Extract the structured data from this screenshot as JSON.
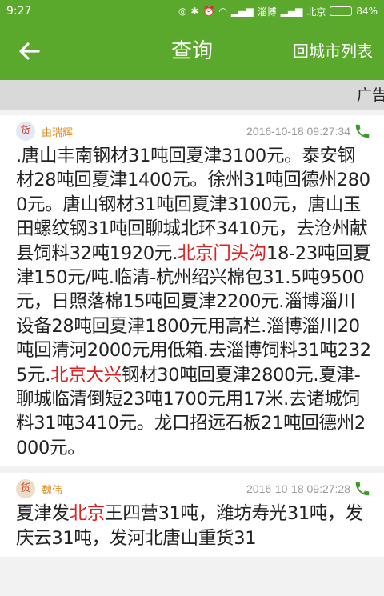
{
  "statusbar": {
    "time": "9:27",
    "carrier1": "淄博",
    "carrier2": "北京",
    "battery": "84%",
    "battery_level": 0.84
  },
  "nav": {
    "title": "查询",
    "right_button": "回城市列表"
  },
  "ad": {
    "label": "广告"
  },
  "posts": [
    {
      "badge": "货",
      "name": "由瑞辉",
      "time": "2016-10-18 09:27:34",
      "segments": [
        {
          "text": ".唐山丰南钢材31吨回夏津3100元。泰安钢材28吨回夏津1400元。徐州31吨回德州2800元。唐山钢材31吨回夏津3100元，唐山玉田螺纹钢31吨回聊城北环3410元，去沧州献县饲料32吨1920元.",
          "highlight": false
        },
        {
          "text": "北京门头沟",
          "highlight": true
        },
        {
          "text": "18-23吨回夏津150元/吨.临清-杭州绍兴棉包31.5吨9500元，日照落棉15吨回夏津2200元.淄博淄川设备28吨回夏津1800元用高栏.淄博淄川20吨回清河2000元用低箱.去淄博饲料31吨2325元.",
          "highlight": false
        },
        {
          "text": "北京大兴",
          "highlight": true
        },
        {
          "text": "钢材30吨回夏津2800元.夏津-聊城临清倒短23吨1700元用17米.去诸城饲料31吨3410元。龙口招远石板21吨回德州2000元。",
          "highlight": false
        }
      ]
    },
    {
      "badge": "货",
      "name": "魏伟",
      "time": "2016-10-18 09:27:28",
      "segments": [
        {
          "text": "夏津发",
          "highlight": false
        },
        {
          "text": "北京",
          "highlight": true
        },
        {
          "text": "王四营31吨，潍坊寿光31吨，发庆云31吨，发河北唐山重货31",
          "highlight": false
        }
      ]
    }
  ],
  "colors": {
    "primary": "#5aa82c",
    "highlight": "#e02020",
    "publisher": "#e08a1e",
    "phone": "#3a9a2a"
  }
}
